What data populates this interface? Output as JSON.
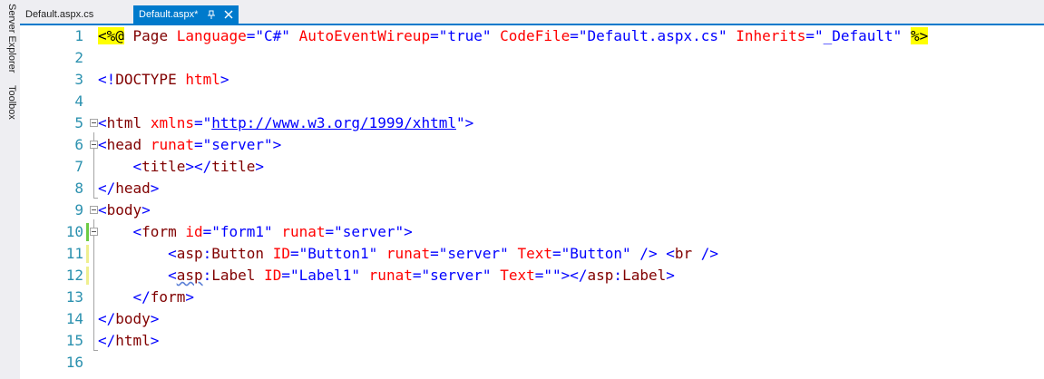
{
  "sidebar": {
    "items": [
      {
        "label": "Server Explorer"
      },
      {
        "label": "Toolbox"
      }
    ]
  },
  "tabs": [
    {
      "label": "Default.aspx.cs",
      "active": false
    },
    {
      "label": "Default.aspx*",
      "active": true,
      "pin_icon": "pin-icon",
      "close_icon": "close-icon"
    }
  ],
  "colors": {
    "accent": "#007acc",
    "line_number": "#2b91af",
    "tag_delimiter": "#0000ff",
    "tag_name": "#800000",
    "attribute": "#ff0000",
    "string_value": "#0000ff",
    "directive_bg": "#ffff00",
    "url": "#0000ff",
    "change_saved": "#6ccb44",
    "change_unsaved": "#efef8f"
  },
  "editor": {
    "lines": [
      {
        "n": "1",
        "tokens": [
          {
            "t": "<%@",
            "c": "dir"
          },
          {
            "t": " Page ",
            "c": "tag"
          },
          {
            "t": "Language",
            "c": "attr"
          },
          {
            "t": "=",
            "c": "val"
          },
          {
            "t": "\"C#\"",
            "c": "val"
          },
          {
            "t": " ",
            "c": "plain"
          },
          {
            "t": "AutoEventWireup",
            "c": "attr"
          },
          {
            "t": "=",
            "c": "val"
          },
          {
            "t": "\"true\"",
            "c": "val"
          },
          {
            "t": " ",
            "c": "plain"
          },
          {
            "t": "CodeFile",
            "c": "attr"
          },
          {
            "t": "=",
            "c": "val"
          },
          {
            "t": "\"Default.aspx.cs\"",
            "c": "val"
          },
          {
            "t": " ",
            "c": "plain"
          },
          {
            "t": "Inherits",
            "c": "attr"
          },
          {
            "t": "=",
            "c": "val"
          },
          {
            "t": "\"_Default\"",
            "c": "val"
          },
          {
            "t": " ",
            "c": "plain"
          },
          {
            "t": "%>",
            "c": "dir"
          }
        ]
      },
      {
        "n": "2",
        "tokens": []
      },
      {
        "n": "3",
        "tokens": [
          {
            "t": "<!",
            "c": "delim"
          },
          {
            "t": "DOCTYPE",
            "c": "tag"
          },
          {
            "t": " ",
            "c": "plain"
          },
          {
            "t": "html",
            "c": "attr"
          },
          {
            "t": ">",
            "c": "delim"
          }
        ]
      },
      {
        "n": "4",
        "tokens": []
      },
      {
        "n": "5",
        "tokens": [
          {
            "t": "<",
            "c": "delim"
          },
          {
            "t": "html",
            "c": "tag"
          },
          {
            "t": " ",
            "c": "plain"
          },
          {
            "t": "xmlns",
            "c": "attr"
          },
          {
            "t": "=\"",
            "c": "val"
          },
          {
            "t": "http://www.w3.org/1999/xhtml",
            "c": "url"
          },
          {
            "t": "\">",
            "c": "val"
          }
        ]
      },
      {
        "n": "6",
        "tokens": [
          {
            "t": "<",
            "c": "delim"
          },
          {
            "t": "head",
            "c": "tag"
          },
          {
            "t": " ",
            "c": "plain"
          },
          {
            "t": "runat",
            "c": "attr"
          },
          {
            "t": "=\"server\">",
            "c": "val"
          }
        ]
      },
      {
        "n": "7",
        "tokens": [
          {
            "t": "    ",
            "c": "plain"
          },
          {
            "t": "<",
            "c": "delim"
          },
          {
            "t": "title",
            "c": "tag"
          },
          {
            "t": "></",
            "c": "delim"
          },
          {
            "t": "title",
            "c": "tag"
          },
          {
            "t": ">",
            "c": "delim"
          }
        ]
      },
      {
        "n": "8",
        "tokens": [
          {
            "t": "</",
            "c": "delim"
          },
          {
            "t": "head",
            "c": "tag"
          },
          {
            "t": ">",
            "c": "delim"
          }
        ]
      },
      {
        "n": "9",
        "tokens": [
          {
            "t": "<",
            "c": "delim"
          },
          {
            "t": "body",
            "c": "tag"
          },
          {
            "t": ">",
            "c": "delim"
          }
        ]
      },
      {
        "n": "10",
        "tokens": [
          {
            "t": "    ",
            "c": "plain"
          },
          {
            "t": "<",
            "c": "delim"
          },
          {
            "t": "form",
            "c": "tag"
          },
          {
            "t": " ",
            "c": "plain"
          },
          {
            "t": "id",
            "c": "attr"
          },
          {
            "t": "=\"form1\"",
            "c": "val"
          },
          {
            "t": " ",
            "c": "plain"
          },
          {
            "t": "runat",
            "c": "attr"
          },
          {
            "t": "=\"server\">",
            "c": "val"
          }
        ]
      },
      {
        "n": "11",
        "tokens": [
          {
            "t": "        ",
            "c": "plain"
          },
          {
            "t": "<",
            "c": "delim"
          },
          {
            "t": "asp",
            "c": "tag"
          },
          {
            "t": ":",
            "c": "delim"
          },
          {
            "t": "Button",
            "c": "tag"
          },
          {
            "t": " ",
            "c": "plain"
          },
          {
            "t": "ID",
            "c": "attr"
          },
          {
            "t": "=\"Button1\"",
            "c": "val"
          },
          {
            "t": " ",
            "c": "plain"
          },
          {
            "t": "runat",
            "c": "attr"
          },
          {
            "t": "=\"server\"",
            "c": "val"
          },
          {
            "t": " ",
            "c": "plain"
          },
          {
            "t": "Text",
            "c": "attr"
          },
          {
            "t": "=\"Button\"",
            "c": "val"
          },
          {
            "t": " />",
            "c": "delim"
          },
          {
            "t": " ",
            "c": "plain"
          },
          {
            "t": "<",
            "c": "delim"
          },
          {
            "t": "br",
            "c": "tag"
          },
          {
            "t": " />",
            "c": "delim"
          }
        ]
      },
      {
        "n": "12",
        "tokens": [
          {
            "t": "        ",
            "c": "plain"
          },
          {
            "t": "<",
            "c": "delim"
          },
          {
            "t": "asp",
            "c": "tag-squiggle"
          },
          {
            "t": ":",
            "c": "delim"
          },
          {
            "t": "Label",
            "c": "tag"
          },
          {
            "t": " ",
            "c": "plain"
          },
          {
            "t": "ID",
            "c": "attr"
          },
          {
            "t": "=\"Label1\"",
            "c": "val"
          },
          {
            "t": " ",
            "c": "plain"
          },
          {
            "t": "runat",
            "c": "attr"
          },
          {
            "t": "=\"server\"",
            "c": "val"
          },
          {
            "t": " ",
            "c": "plain"
          },
          {
            "t": "Text",
            "c": "attr"
          },
          {
            "t": "=\"\">",
            "c": "val"
          },
          {
            "t": "</",
            "c": "delim"
          },
          {
            "t": "asp",
            "c": "tag"
          },
          {
            "t": ":",
            "c": "delim"
          },
          {
            "t": "Label",
            "c": "tag"
          },
          {
            "t": ">",
            "c": "delim"
          }
        ]
      },
      {
        "n": "13",
        "tokens": [
          {
            "t": "    ",
            "c": "plain"
          },
          {
            "t": "</",
            "c": "delim"
          },
          {
            "t": "form",
            "c": "tag"
          },
          {
            "t": ">",
            "c": "delim"
          }
        ]
      },
      {
        "n": "14",
        "tokens": [
          {
            "t": "</",
            "c": "delim"
          },
          {
            "t": "body",
            "c": "tag"
          },
          {
            "t": ">",
            "c": "delim"
          }
        ]
      },
      {
        "n": "15",
        "tokens": [
          {
            "t": "</",
            "c": "delim"
          },
          {
            "t": "html",
            "c": "tag"
          },
          {
            "t": ">",
            "c": "delim"
          }
        ]
      },
      {
        "n": "16",
        "tokens": []
      }
    ]
  }
}
